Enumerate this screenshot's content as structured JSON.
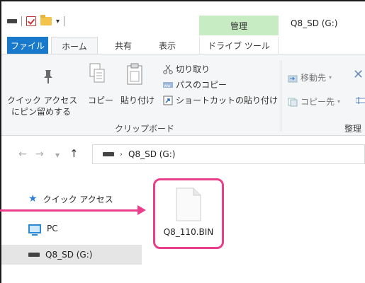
{
  "window": {
    "title": "Q8_SD (G:)",
    "manage_tab": "管理"
  },
  "ribbon_tabs": {
    "file": "ファイル",
    "home": "ホーム",
    "share": "共有",
    "view": "表示",
    "drive_tools": "ドライブ ツール"
  },
  "clipboard": {
    "pin_label_line1": "クイック アクセス",
    "pin_label_line2": "にピン留めする",
    "copy_label": "コピー",
    "paste_label": "貼り付け",
    "cut_label": "切り取り",
    "copy_path_label": "パスのコピー",
    "paste_shortcut_label": "ショートカットの貼り付け",
    "group_label": "クリップボード"
  },
  "organize": {
    "move_to_label": "移動先",
    "copy_to_label": "コピー先",
    "group_label": "整理"
  },
  "address_bar": {
    "path": "Q8_SD (G:)"
  },
  "nav_pane": {
    "items": [
      {
        "label": "クイック アクセス",
        "icon": "star-icon"
      },
      {
        "label": "PC",
        "icon": "pc-icon"
      },
      {
        "label": "Q8_SD (G:)",
        "icon": "drive-icon"
      }
    ]
  },
  "files": [
    {
      "name": "Q8_110.BIN",
      "icon": "file-icon"
    }
  ],
  "colors": {
    "accent": "#1979ca",
    "manage": "#c7ebc2",
    "highlight": "#e83e8c"
  }
}
